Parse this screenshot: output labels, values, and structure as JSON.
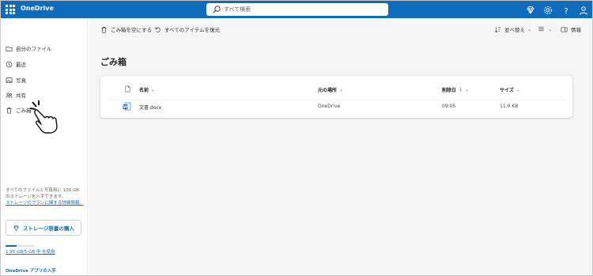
{
  "app": {
    "name": "OneDrive"
  },
  "search": {
    "placeholder": "すべて検索"
  },
  "nav": {
    "items": [
      {
        "label": "自分のファイル",
        "icon": "folder-icon"
      },
      {
        "label": "最近",
        "icon": "clock-icon"
      },
      {
        "label": "写真",
        "icon": "image-icon"
      },
      {
        "label": "共有",
        "icon": "people-icon"
      },
      {
        "label": "ごみ箱",
        "icon": "trash-icon"
      }
    ],
    "storage_info": "すべてのファイルと写真用に 100 GB のストレージを入手できます。",
    "storage_link": "ストレージのプランに関する詳細情報。",
    "buy_button": "ストレージ容量の購入",
    "storage_used": "1.95 GB/5 GB 中 を使用",
    "storage_fraction": 0.39,
    "app_link": "OneDrive アプリの入手"
  },
  "toolbar": {
    "empty_trash": "ごみ箱を空にする",
    "restore_all": "すべてのアイテムを復元",
    "sort": "並べ替え",
    "info": "情報"
  },
  "page": {
    "title": "ごみ箱"
  },
  "table": {
    "columns": {
      "name": "名前",
      "location": "元の場所",
      "deleted": "削除日",
      "size": "サイズ"
    },
    "rows": [
      {
        "name": "文書.docx",
        "location": "OneDrive",
        "deleted": "09:05",
        "size": "11.0 KB"
      }
    ]
  },
  "colors": {
    "brand": "#0f6cbd",
    "background": "#f5f5f5"
  }
}
